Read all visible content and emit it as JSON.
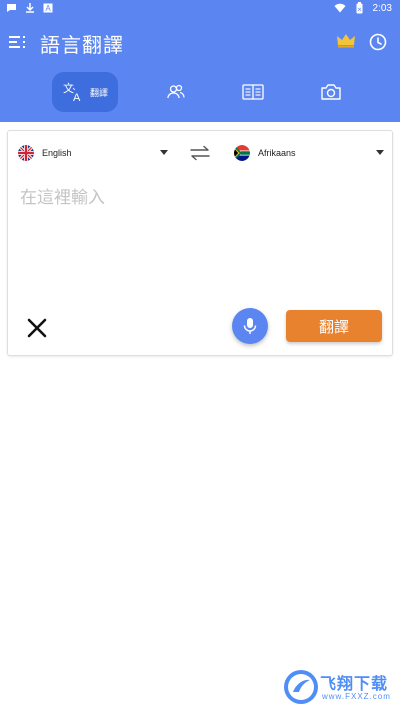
{
  "status_bar": {
    "time": "2:03",
    "left_icons": [
      "message-icon",
      "download-icon",
      "app-a-icon"
    ],
    "right_icons": [
      "wifi-icon",
      "battery-icon"
    ]
  },
  "header": {
    "title": "語言翻譯",
    "menu_icon": "menu-icon",
    "crown_icon": "crown-icon",
    "history_icon": "history-icon"
  },
  "tabs": [
    {
      "id": "translate",
      "label": "翻譯",
      "icon": "translate-icon",
      "active": true
    },
    {
      "id": "conversation",
      "label": "",
      "icon": "people-icon",
      "active": false
    },
    {
      "id": "dictionary",
      "label": "",
      "icon": "book-icon",
      "active": false
    },
    {
      "id": "camera",
      "label": "",
      "icon": "camera-icon",
      "active": false
    }
  ],
  "card": {
    "source_language": "English",
    "target_language": "Afrikaans",
    "input_placeholder": "在這裡輸入",
    "input_value": "",
    "translate_button": "翻譯"
  },
  "watermark": {
    "text": "飞翔下载",
    "subtext": "www.FXXZ.com"
  },
  "colors": {
    "header_bg": "#5b86f2",
    "active_tab_bg": "#3e6ddd",
    "translate_button_bg": "#e9822f",
    "mic_button_bg": "#5b86f2",
    "crown": "#f2c43c"
  }
}
